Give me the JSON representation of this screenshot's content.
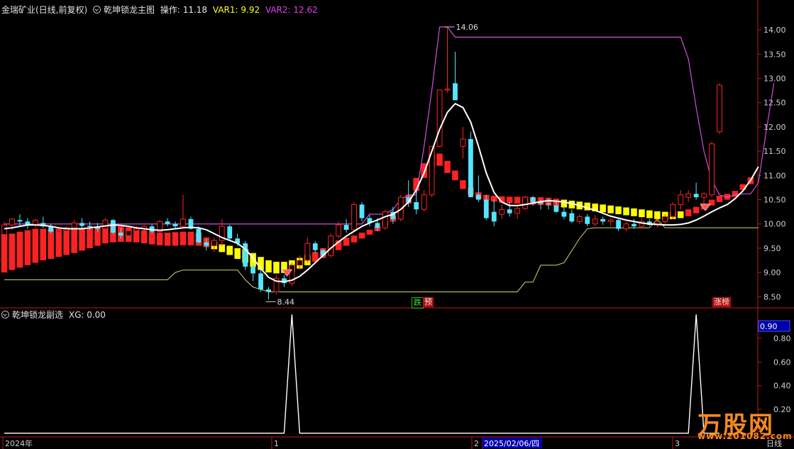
{
  "main_header": {
    "stock": "金瑞矿业(日线,前复权)",
    "indicator": "乾坤锁龙主图",
    "op_label": "操作: 11.18",
    "var1": "VAR1: 9.92",
    "var2": "VAR2: 12.62"
  },
  "sub_header": {
    "indicator": "乾坤锁龙副选",
    "xg": "XG: 0.00"
  },
  "tags": {
    "die": "跌",
    "yu": "预",
    "zhang": "涨榜",
    "high_label": "14.06",
    "low_label": "8.44",
    "cursor_value": "0.90"
  },
  "x_axis": {
    "labels": [
      "2024年",
      "1",
      "2",
      "2025/02/06/四",
      "3"
    ],
    "period": "日线"
  },
  "watermark": {
    "brand": "万股网",
    "site": "www.201082.com"
  },
  "colors": {
    "up": "#ff2222",
    "down": "#55e5ff",
    "white": "#ffffff",
    "magenta": "#d050d8",
    "yellow": "#ffff00",
    "olive": "#d8d860",
    "axis": "#c01818",
    "text": "#d0d0d0"
  },
  "chart_data": [
    {
      "type": "candlestick",
      "y_axis": {
        "ticks": [
          8.5,
          9.0,
          9.5,
          10.0,
          10.5,
          11.0,
          11.5,
          12.0,
          12.5,
          13.0,
          13.5,
          14.0
        ],
        "range": [
          8.3,
          14.25
        ]
      },
      "candles": [
        {
          "o": 9.78,
          "h": 10.05,
          "l": 9.55,
          "c": 9.98
        },
        {
          "o": 9.98,
          "h": 10.12,
          "l": 9.88,
          "c": 10.1
        },
        {
          "o": 10.08,
          "h": 10.2,
          "l": 9.95,
          "c": 10.05
        },
        {
          "o": 10.05,
          "h": 10.12,
          "l": 9.9,
          "c": 9.98
        },
        {
          "o": 9.98,
          "h": 10.1,
          "l": 9.92,
          "c": 10.08
        },
        {
          "o": 10.02,
          "h": 10.15,
          "l": 9.92,
          "c": 9.95
        },
        {
          "o": 9.95,
          "h": 10.0,
          "l": 9.8,
          "c": 9.84
        },
        {
          "o": 9.84,
          "h": 9.92,
          "l": 9.74,
          "c": 9.86
        },
        {
          "o": 9.86,
          "h": 9.95,
          "l": 9.78,
          "c": 9.92
        },
        {
          "o": 9.92,
          "h": 10.08,
          "l": 9.86,
          "c": 10.02
        },
        {
          "o": 10.02,
          "h": 10.12,
          "l": 9.92,
          "c": 9.96
        },
        {
          "o": 9.96,
          "h": 10.05,
          "l": 9.88,
          "c": 9.94
        },
        {
          "o": 9.94,
          "h": 10.02,
          "l": 9.84,
          "c": 9.9
        },
        {
          "o": 9.9,
          "h": 10.12,
          "l": 9.85,
          "c": 10.08
        },
        {
          "o": 10.08,
          "h": 10.1,
          "l": 9.78,
          "c": 9.82
        },
        {
          "o": 9.82,
          "h": 9.92,
          "l": 9.7,
          "c": 9.76
        },
        {
          "o": 9.76,
          "h": 9.88,
          "l": 9.7,
          "c": 9.86
        },
        {
          "o": 9.86,
          "h": 9.96,
          "l": 9.8,
          "c": 9.9
        },
        {
          "o": 9.9,
          "h": 9.98,
          "l": 9.82,
          "c": 9.95
        },
        {
          "o": 9.95,
          "h": 9.99,
          "l": 9.8,
          "c": 9.84
        },
        {
          "o": 9.84,
          "h": 10.08,
          "l": 9.82,
          "c": 10.05
        },
        {
          "o": 10.05,
          "h": 10.12,
          "l": 9.95,
          "c": 10.0
        },
        {
          "o": 10.0,
          "h": 10.05,
          "l": 9.9,
          "c": 9.95
        },
        {
          "o": 9.95,
          "h": 10.6,
          "l": 9.92,
          "c": 10.1
        },
        {
          "o": 10.1,
          "h": 10.15,
          "l": 9.88,
          "c": 9.9
        },
        {
          "o": 9.9,
          "h": 9.95,
          "l": 9.6,
          "c": 9.62
        },
        {
          "o": 9.62,
          "h": 9.7,
          "l": 9.45,
          "c": 9.55
        },
        {
          "o": 9.55,
          "h": 9.72,
          "l": 9.42,
          "c": 9.66
        },
        {
          "o": 9.66,
          "h": 10.1,
          "l": 9.55,
          "c": 9.95
        },
        {
          "o": 9.95,
          "h": 9.98,
          "l": 9.65,
          "c": 9.7
        },
        {
          "o": 9.7,
          "h": 9.8,
          "l": 9.55,
          "c": 9.6
        },
        {
          "o": 9.6,
          "h": 9.65,
          "l": 9.05,
          "c": 9.12
        },
        {
          "o": 9.12,
          "h": 9.2,
          "l": 8.82,
          "c": 8.98
        },
        {
          "o": 8.98,
          "h": 9.05,
          "l": 8.6,
          "c": 8.65
        },
        {
          "o": 8.65,
          "h": 8.7,
          "l": 8.44,
          "c": 8.6
        },
        {
          "o": 8.6,
          "h": 8.95,
          "l": 8.55,
          "c": 8.88
        },
        {
          "o": 8.88,
          "h": 8.95,
          "l": 8.7,
          "c": 8.78
        },
        {
          "o": 8.78,
          "h": 9.2,
          "l": 8.72,
          "c": 9.15
        },
        {
          "o": 9.15,
          "h": 9.35,
          "l": 9.05,
          "c": 9.25
        },
        {
          "o": 9.25,
          "h": 9.72,
          "l": 9.2,
          "c": 9.6
        },
        {
          "o": 9.6,
          "h": 9.65,
          "l": 9.4,
          "c": 9.46
        },
        {
          "o": 9.46,
          "h": 9.5,
          "l": 9.3,
          "c": 9.35
        },
        {
          "o": 9.35,
          "h": 9.8,
          "l": 9.3,
          "c": 9.75
        },
        {
          "o": 9.75,
          "h": 10.05,
          "l": 9.7,
          "c": 9.98
        },
        {
          "o": 9.98,
          "h": 10.1,
          "l": 9.82,
          "c": 9.88
        },
        {
          "o": 9.88,
          "h": 10.45,
          "l": 9.85,
          "c": 10.4
        },
        {
          "o": 10.4,
          "h": 10.45,
          "l": 10.05,
          "c": 10.12
        },
        {
          "o": 10.12,
          "h": 10.18,
          "l": 9.95,
          "c": 10.02
        },
        {
          "o": 10.02,
          "h": 10.12,
          "l": 9.85,
          "c": 9.92
        },
        {
          "o": 9.92,
          "h": 10.3,
          "l": 9.88,
          "c": 10.25
        },
        {
          "o": 10.25,
          "h": 10.35,
          "l": 10.0,
          "c": 10.1
        },
        {
          "o": 10.1,
          "h": 10.6,
          "l": 10.05,
          "c": 10.55
        },
        {
          "o": 10.55,
          "h": 10.9,
          "l": 10.35,
          "c": 10.45
        },
        {
          "o": 10.45,
          "h": 10.7,
          "l": 10.2,
          "c": 10.3
        },
        {
          "o": 10.3,
          "h": 10.7,
          "l": 10.25,
          "c": 10.6
        },
        {
          "o": 10.6,
          "h": 11.6,
          "l": 10.55,
          "c": 11.6
        },
        {
          "o": 11.6,
          "h": 12.76,
          "l": 11.58,
          "c": 12.76
        },
        {
          "o": 12.76,
          "h": 14.06,
          "l": 12.7,
          "c": 12.78
        },
        {
          "o": 12.9,
          "h": 13.55,
          "l": 12.6,
          "c": 12.55
        },
        {
          "o": 11.6,
          "h": 12.0,
          "l": 11.35,
          "c": 11.75
        },
        {
          "o": 11.75,
          "h": 11.9,
          "l": 10.6,
          "c": 10.55
        },
        {
          "o": 10.6,
          "h": 11.0,
          "l": 10.45,
          "c": 10.5
        },
        {
          "o": 10.5,
          "h": 10.6,
          "l": 10.08,
          "c": 10.12
        },
        {
          "o": 10.25,
          "h": 10.5,
          "l": 9.95,
          "c": 10.05
        },
        {
          "o": 10.2,
          "h": 10.4,
          "l": 10.1,
          "c": 10.3
        },
        {
          "o": 10.3,
          "h": 10.45,
          "l": 10.15,
          "c": 10.22
        },
        {
          "o": 10.22,
          "h": 10.38,
          "l": 10.1,
          "c": 10.32
        },
        {
          "o": 10.32,
          "h": 10.58,
          "l": 10.28,
          "c": 10.55
        },
        {
          "o": 10.55,
          "h": 10.58,
          "l": 10.38,
          "c": 10.45
        },
        {
          "o": 10.45,
          "h": 10.5,
          "l": 10.3,
          "c": 10.42
        },
        {
          "o": 10.42,
          "h": 10.52,
          "l": 10.3,
          "c": 10.4
        },
        {
          "o": 10.38,
          "h": 10.45,
          "l": 10.22,
          "c": 10.25
        },
        {
          "o": 10.25,
          "h": 10.38,
          "l": 10.1,
          "c": 10.15
        },
        {
          "o": 10.22,
          "h": 10.3,
          "l": 10.02,
          "c": 10.05
        },
        {
          "o": 10.05,
          "h": 10.2,
          "l": 10.0,
          "c": 10.15
        },
        {
          "o": 10.15,
          "h": 10.2,
          "l": 9.95,
          "c": 10.0
        },
        {
          "o": 10.0,
          "h": 10.18,
          "l": 9.95,
          "c": 10.1
        },
        {
          "o": 10.1,
          "h": 10.15,
          "l": 9.98,
          "c": 10.05
        },
        {
          "o": 10.05,
          "h": 10.12,
          "l": 9.96,
          "c": 10.08
        },
        {
          "o": 10.08,
          "h": 10.1,
          "l": 9.85,
          "c": 9.9
        },
        {
          "o": 9.9,
          "h": 10.05,
          "l": 9.85,
          "c": 10.0
        },
        {
          "o": 10.0,
          "h": 10.1,
          "l": 9.9,
          "c": 9.95
        },
        {
          "o": 9.95,
          "h": 10.12,
          "l": 9.92,
          "c": 10.05
        },
        {
          "o": 10.05,
          "h": 10.1,
          "l": 9.96,
          "c": 9.98
        },
        {
          "o": 9.98,
          "h": 10.1,
          "l": 9.92,
          "c": 10.05
        },
        {
          "o": 10.05,
          "h": 10.2,
          "l": 10.0,
          "c": 10.15
        },
        {
          "o": 10.15,
          "h": 10.45,
          "l": 10.1,
          "c": 10.4
        },
        {
          "o": 10.4,
          "h": 10.7,
          "l": 10.3,
          "c": 10.6
        },
        {
          "o": 10.55,
          "h": 10.7,
          "l": 10.45,
          "c": 10.62
        },
        {
          "o": 10.62,
          "h": 10.85,
          "l": 10.5,
          "c": 10.55
        },
        {
          "o": 10.55,
          "h": 10.65,
          "l": 10.4,
          "c": 10.62
        },
        {
          "o": 10.6,
          "h": 11.7,
          "l": 10.55,
          "c": 11.65
        },
        {
          "o": 11.9,
          "h": 12.9,
          "l": 11.85,
          "c": 12.86
        }
      ],
      "white_line": [
        9.9,
        9.92,
        9.95,
        9.98,
        9.98,
        9.97,
        9.95,
        9.92,
        9.9,
        9.9,
        9.9,
        9.92,
        9.94,
        9.96,
        9.98,
        9.97,
        9.95,
        9.92,
        9.9,
        9.88,
        9.87,
        9.88,
        9.9,
        9.92,
        9.93,
        9.92,
        9.88,
        9.8,
        9.72,
        9.66,
        9.6,
        9.48,
        9.3,
        9.08,
        8.9,
        8.82,
        8.81,
        8.84,
        8.92,
        9.05,
        9.2,
        9.35,
        9.5,
        9.63,
        9.75,
        9.85,
        9.95,
        10.02,
        10.08,
        10.15,
        10.2,
        10.3,
        10.45,
        10.7,
        11.05,
        11.5,
        11.95,
        12.3,
        12.48,
        12.4,
        12.1,
        11.6,
        11.05,
        10.65,
        10.45,
        10.38,
        10.38,
        10.4,
        10.43,
        10.46,
        10.48,
        10.47,
        10.45,
        10.42,
        10.38,
        10.33,
        10.28,
        10.22,
        10.16,
        10.12,
        10.08,
        10.05,
        10.02,
        10.0,
        9.99,
        9.98,
        9.98,
        9.99,
        10.02,
        10.08,
        10.16,
        10.25,
        10.33,
        10.4,
        10.52,
        10.68,
        10.9,
        11.18
      ],
      "magenta_line": [
        10.0,
        10.0,
        10.0,
        10.0,
        10.0,
        10.0,
        10.0,
        10.0,
        10.0,
        10.0,
        10.0,
        10.0,
        10.0,
        10.0,
        10.0,
        10.0,
        10.0,
        10.0,
        10.0,
        10.0,
        10.0,
        10.0,
        10.0,
        10.0,
        10.0,
        10.0,
        10.0,
        10.0,
        10.0,
        10.0,
        10.0,
        10.0,
        10.0,
        10.0,
        10.0,
        10.0,
        10.0,
        10.0,
        10.0,
        10.0,
        10.0,
        10.0,
        10.0,
        10.0,
        10.0,
        10.0,
        10.0,
        10.2,
        10.2,
        10.2,
        10.3,
        10.5,
        10.6,
        10.6,
        11.6,
        12.76,
        14.06,
        14.06,
        13.85,
        13.85,
        13.85,
        13.85,
        13.85,
        13.85,
        13.85,
        13.85,
        13.85,
        13.85,
        13.85,
        13.85,
        13.85,
        13.85,
        13.85,
        13.85,
        13.85,
        13.85,
        13.85,
        13.85,
        13.85,
        13.85,
        13.85,
        13.85,
        13.85,
        13.85,
        13.85,
        13.85,
        13.85,
        13.85,
        13.4,
        12.4,
        11.5,
        10.9,
        10.6,
        10.55,
        10.6,
        10.62,
        10.62,
        10.85,
        11.9,
        12.9
      ],
      "yellow_line": [
        8.85,
        8.85,
        8.85,
        8.85,
        8.85,
        8.85,
        8.85,
        8.85,
        8.85,
        8.85,
        8.85,
        8.85,
        8.85,
        8.85,
        8.85,
        8.85,
        8.85,
        8.85,
        8.85,
        8.85,
        8.85,
        8.85,
        9.0,
        9.05,
        9.05,
        9.05,
        9.05,
        9.05,
        9.05,
        9.05,
        9.05,
        8.85,
        8.7,
        8.65,
        8.6,
        8.6,
        8.6,
        8.6,
        8.6,
        8.6,
        8.6,
        8.6,
        8.6,
        8.6,
        8.6,
        8.6,
        8.6,
        8.6,
        8.6,
        8.6,
        8.6,
        8.6,
        8.6,
        8.6,
        8.6,
        8.6,
        8.6,
        8.6,
        8.6,
        8.6,
        8.6,
        8.6,
        8.6,
        8.6,
        8.6,
        8.6,
        8.6,
        8.8,
        8.8,
        9.15,
        9.15,
        9.15,
        9.2,
        9.45,
        9.7,
        9.9,
        9.92,
        9.92,
        9.92,
        9.92,
        9.92,
        9.92,
        9.92,
        9.92,
        10.1,
        9.92,
        9.92,
        9.92,
        9.92,
        9.92,
        9.92,
        9.92,
        9.92,
        9.92,
        9.92,
        9.92,
        9.92,
        9.92
      ],
      "band_top": [
        9.78,
        9.8,
        9.84,
        9.87,
        9.9,
        9.9,
        9.9,
        9.9,
        9.9,
        9.92,
        9.92,
        9.93,
        9.94,
        9.96,
        9.96,
        9.95,
        9.93,
        9.9,
        9.87,
        9.84,
        9.82,
        9.82,
        9.83,
        9.84,
        9.84,
        9.82,
        9.72,
        9.62,
        9.58,
        9.55,
        9.5,
        9.48,
        9.4,
        9.32,
        9.25,
        9.22,
        9.22,
        9.25,
        9.3,
        9.36,
        9.42,
        9.5,
        9.58,
        9.66,
        9.72,
        9.76,
        9.82,
        9.88,
        9.95,
        10.05,
        10.18,
        10.35,
        10.6,
        10.95,
        11.25,
        11.45,
        11.45,
        11.3,
        11.1,
        10.9,
        10.75,
        10.65,
        10.6,
        10.58,
        10.57,
        10.56,
        10.56,
        10.56,
        10.55,
        10.55,
        10.54,
        10.52,
        10.5,
        10.48,
        10.46,
        10.44,
        10.42,
        10.4,
        10.38,
        10.36,
        10.34,
        10.32,
        10.3,
        10.28,
        10.26,
        10.25,
        10.25,
        10.26,
        10.3,
        10.35,
        10.42,
        10.5,
        10.58,
        10.62,
        10.68,
        10.82,
        10.96
      ],
      "band_bottom": [
        9.0,
        9.05,
        9.1,
        9.15,
        9.2,
        9.25,
        9.28,
        9.32,
        9.36,
        9.4,
        9.45,
        9.5,
        9.55,
        9.6,
        9.62,
        9.63,
        9.63,
        9.62,
        9.6,
        9.58,
        9.56,
        9.55,
        9.55,
        9.56,
        9.56,
        9.55,
        9.52,
        9.48,
        9.42,
        9.36,
        9.28,
        9.2,
        9.12,
        9.05,
        9.0,
        8.98,
        8.99,
        9.02,
        9.08,
        9.15,
        9.22,
        9.3,
        9.38,
        9.46,
        9.55,
        9.62,
        9.7,
        9.78,
        9.85,
        9.95,
        10.05,
        10.2,
        10.42,
        10.68,
        10.95,
        11.18,
        11.2,
        11.05,
        10.9,
        10.72,
        10.6,
        10.52,
        10.48,
        10.46,
        10.44,
        10.43,
        10.42,
        10.41,
        10.4,
        10.39,
        10.38,
        10.36,
        10.34,
        10.32,
        10.3,
        10.28,
        10.26,
        10.24,
        10.22,
        10.2,
        10.18,
        10.16,
        10.14,
        10.12,
        10.1,
        10.09,
        10.1,
        10.12,
        10.16,
        10.22,
        10.3,
        10.38,
        10.45,
        10.5,
        10.56,
        10.7,
        10.82
      ],
      "band_color": [
        "r",
        "r",
        "r",
        "r",
        "r",
        "r",
        "r",
        "r",
        "r",
        "r",
        "r",
        "r",
        "r",
        "r",
        "r",
        "r",
        "r",
        "r",
        "r",
        "r",
        "r",
        "r",
        "r",
        "r",
        "r",
        "r",
        "r",
        "y",
        "y",
        "y",
        "y",
        "y",
        "y",
        "y",
        "y",
        "y",
        "y",
        "y",
        "y",
        "y",
        "r",
        "r",
        "r",
        "r",
        "r",
        "r",
        "r",
        "r",
        "r",
        "r",
        "r",
        "r",
        "r",
        "r",
        "r",
        "r",
        "r",
        "r",
        "r",
        "r",
        "r",
        "r",
        "r",
        "r",
        "r",
        "r",
        "r",
        "r",
        "r",
        "r",
        "r",
        "r",
        "y",
        "y",
        "y",
        "y",
        "y",
        "y",
        "y",
        "y",
        "y",
        "y",
        "y",
        "y",
        "y",
        "y",
        "y",
        "y",
        "r",
        "r",
        "r",
        "r",
        "r",
        "r",
        "r",
        "r",
        "r"
      ]
    },
    {
      "type": "line",
      "name": "XG",
      "y_axis": {
        "ticks": [
          0.2,
          0.4,
          0.6,
          0.8
        ],
        "range": [
          -0.02,
          1.02
        ]
      },
      "spikes": [
        {
          "index": 37,
          "value": 1.0
        },
        {
          "index": 89,
          "value": 1.0
        }
      ]
    }
  ]
}
